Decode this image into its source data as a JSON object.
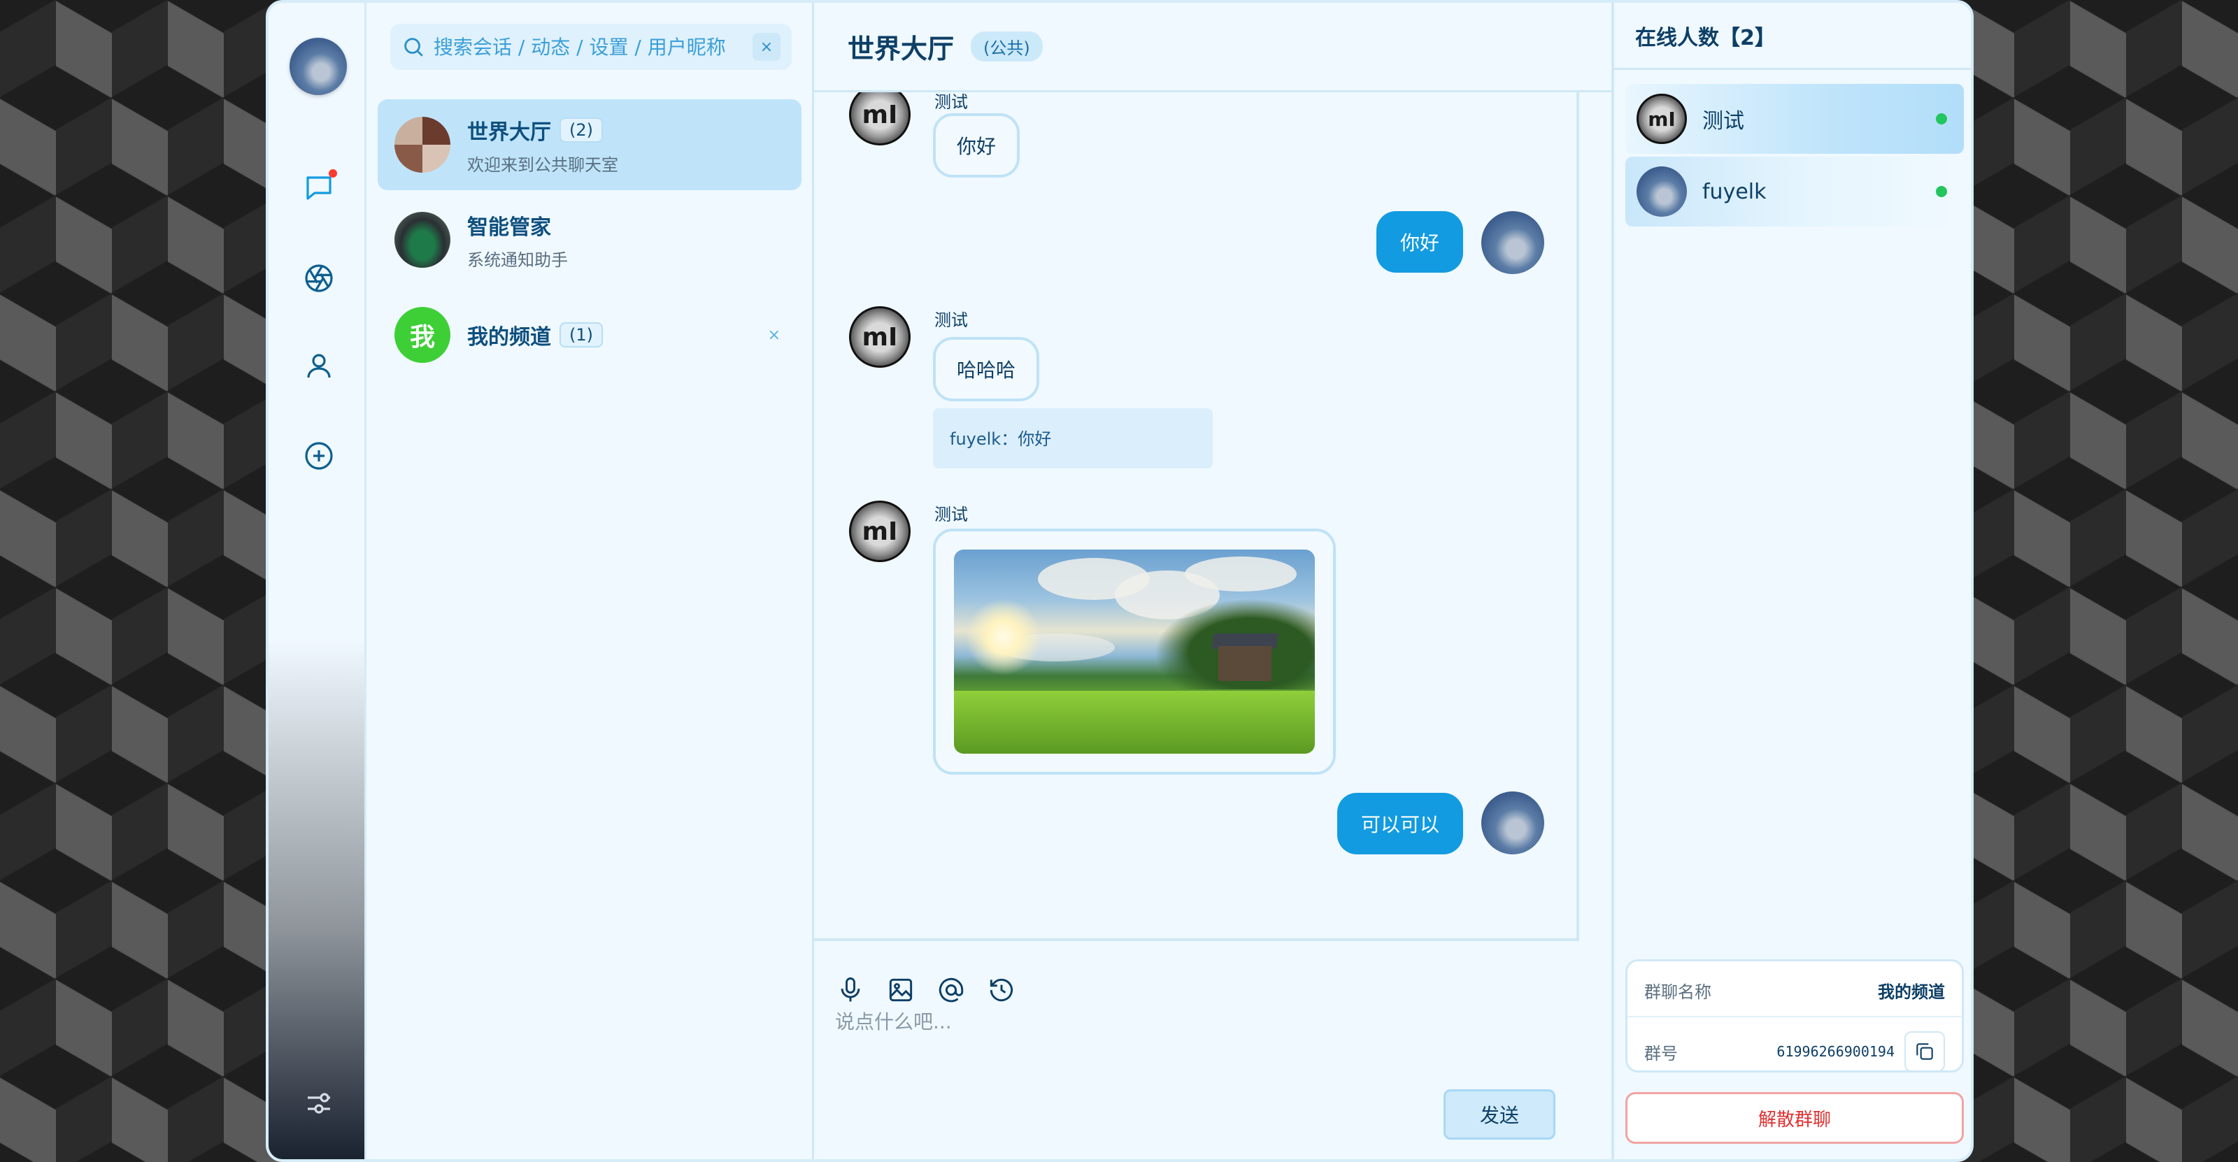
{
  "search": {
    "placeholder": "搜索会话 / 动态 / 设置 / 用户昵称",
    "clear_label": "×"
  },
  "conversations": [
    {
      "title": "世界大厅",
      "count": "(2)",
      "subtitle": "欢迎来到公共聊天室",
      "active": true
    },
    {
      "title": "智能管家",
      "subtitle": "系统通知助手"
    },
    {
      "title": "我的频道",
      "count": "(1)",
      "avatar_text": "我",
      "close_label": "×"
    }
  ],
  "chat": {
    "title": "世界大厅",
    "tag": "(公共)",
    "messages": [
      {
        "from": "other",
        "name": "测试",
        "text": "你好"
      },
      {
        "from": "me",
        "text": "你好"
      },
      {
        "from": "other",
        "name": "测试",
        "text": "哈哈哈",
        "quote": "fuyelk：你好"
      },
      {
        "from": "other",
        "name": "测试",
        "type": "image"
      },
      {
        "from": "me",
        "text": "可以可以"
      }
    ],
    "composer": {
      "placeholder": "说点什么吧...",
      "send_label": "发送"
    }
  },
  "right_panel": {
    "online_header": "在线人数【2】",
    "members": [
      {
        "name": "测试",
        "status": "online"
      },
      {
        "name": "fuyelk",
        "status": "online"
      }
    ],
    "group": {
      "name_label": "群聊名称",
      "name_value": "我的频道",
      "id_label": "群号",
      "id_value": "61996266900194"
    },
    "dissolve_label": "解散群聊"
  },
  "colors": {
    "accent": "#129be0",
    "online": "#22c55e",
    "danger": "#e03131",
    "notification_dot": "#ff3b30"
  },
  "icons": {
    "rail": [
      "chat-icon",
      "aperture-icon",
      "user-icon",
      "plus-circle-icon",
      "settings-sliders-icon"
    ],
    "composer": [
      "microphone-icon",
      "image-icon",
      "at-icon",
      "history-icon"
    ]
  }
}
